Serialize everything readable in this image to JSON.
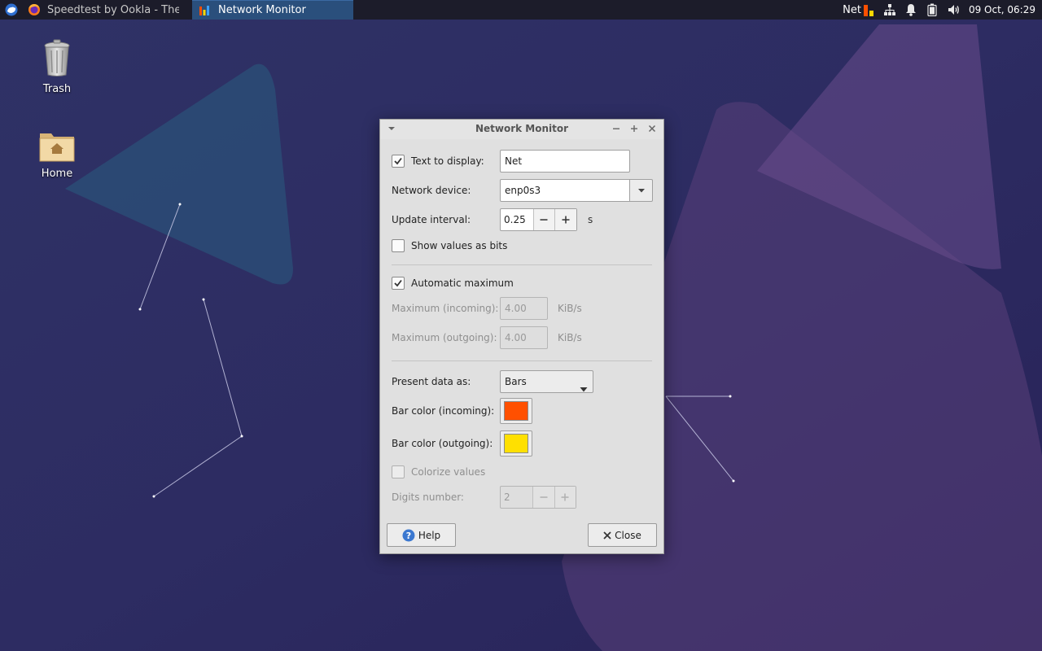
{
  "panel": {
    "tasks": [
      {
        "label": "Speedtest by Ookla - The Gl..."
      },
      {
        "label": "Network Monitor"
      }
    ],
    "tray": {
      "net_label": "Net",
      "clock": "09 Oct, 06:29"
    }
  },
  "desktop": {
    "icons": [
      {
        "label": "Trash"
      },
      {
        "label": "Home"
      }
    ]
  },
  "dialog": {
    "title": "Network Monitor",
    "text_to_display": {
      "label": "Text to display:",
      "checked": true,
      "value": "Net"
    },
    "network_device": {
      "label": "Network device:",
      "value": "enp0s3"
    },
    "update_interval": {
      "label": "Update interval:",
      "value": "0.25",
      "unit": "s"
    },
    "show_bits": {
      "label": "Show values as bits",
      "checked": false
    },
    "auto_max": {
      "label": "Automatic maximum",
      "checked": true
    },
    "max_incoming": {
      "label": "Maximum (incoming):",
      "value": "4.00",
      "unit": "KiB/s"
    },
    "max_outgoing": {
      "label": "Maximum (outgoing):",
      "value": "4.00",
      "unit": "KiB/s"
    },
    "present_as": {
      "label": "Present data as:",
      "value": "Bars"
    },
    "bar_incoming": {
      "label": "Bar color (incoming):",
      "color": "#ff5000"
    },
    "bar_outgoing": {
      "label": "Bar color (outgoing):",
      "color": "#ffe000"
    },
    "colorize": {
      "label": "Colorize values",
      "checked": false
    },
    "digits": {
      "label": "Digits number:",
      "value": "2"
    },
    "help_label": "Help",
    "close_label": "Close"
  },
  "colors": {
    "panel_bg": "#1c1c2a",
    "active_task": "#2a4f7c",
    "dialog_bg": "#e0e0e0"
  }
}
